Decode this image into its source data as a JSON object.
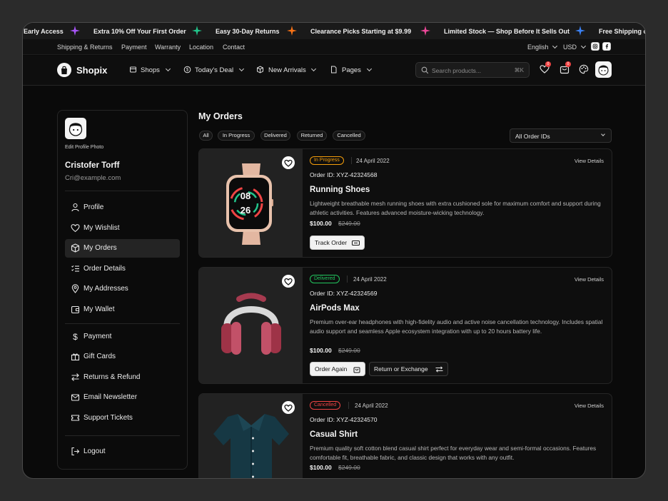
{
  "marquee": {
    "items": [
      "Early Access",
      "Extra 10% Off Your First Order",
      "Easy 30-Day Returns",
      "Clearance Picks Starting at $9.99",
      "Limited Stock — Shop Before It Sells Out",
      "Free Shipping o"
    ],
    "star_colors": [
      "#a855f7",
      "#22c58b",
      "#f97316",
      "#ec4899",
      "#3b82f6"
    ]
  },
  "utility": {
    "links": [
      "Shipping & Returns",
      "Payment",
      "Warranty",
      "Location",
      "Contact"
    ],
    "language": "English",
    "currency": "USD"
  },
  "header": {
    "brand": "Shopix",
    "nav": [
      "Shops",
      "Today's Deal",
      "New Arrivals",
      "Pages"
    ],
    "search_placeholder": "Search products...",
    "search_shortcut": "⌘K",
    "wishlist_count": "0",
    "cart_count": "0"
  },
  "sidebar": {
    "edit_photo": "Edit Profile Photo",
    "name": "Cristofer Torff",
    "email": "Cri@example.com",
    "group1": [
      {
        "label": "Profile",
        "icon": "user-icon"
      },
      {
        "label": "My Wishlist",
        "icon": "heart-icon"
      },
      {
        "label": "My Orders",
        "icon": "box-icon",
        "active": true
      },
      {
        "label": "Order Details",
        "icon": "list-icon"
      },
      {
        "label": "My Addresses",
        "icon": "map-pin-icon"
      },
      {
        "label": "My Wallet",
        "icon": "wallet-icon"
      }
    ],
    "group2": [
      {
        "label": "Payment",
        "icon": "dollar-icon"
      },
      {
        "label": "Gift Cards",
        "icon": "gift-icon"
      },
      {
        "label": "Returns & Refund",
        "icon": "swap-icon"
      },
      {
        "label": "Email Newsletter",
        "icon": "mail-icon"
      },
      {
        "label": "Support Tickets",
        "icon": "ticket-icon"
      }
    ],
    "logout": "Logout"
  },
  "main": {
    "title": "My Orders",
    "filters": [
      "All",
      "In Progress",
      "Delivered",
      "Returned",
      "Cancelled"
    ],
    "order_select": "All Order IDs",
    "orders": [
      {
        "status": "In Progress",
        "status_color": "#f59e0b",
        "date": "24 April 2022",
        "view": "View Details",
        "order_id": "Order ID: XYZ-42324568",
        "title": "Running Shoes",
        "desc": "Lightweight breathable mesh running shoes with extra cushioned sole for maximum comfort and support during athletic activities. Features advanced moisture-wicking technology.",
        "price": "$100.00",
        "old_price": "$249.00",
        "buttons": [
          "Track Order"
        ],
        "image": "smartwatch",
        "watch_time_hour": "08",
        "watch_time_min": "26"
      },
      {
        "status": "Delivered",
        "status_color": "#22c55e",
        "date": "24 April 2022",
        "view": "View Details",
        "order_id": "Order ID: XYZ-42324569",
        "title": "AirPods Max",
        "desc": "Premium over-ear headphones with high-fidelity audio and active noise cancellation technology. Includes spatial audio support and seamless Apple ecosystem integration with up to 20 hours battery life.",
        "price": "$100.00",
        "old_price": "$249.00",
        "buttons": [
          "Order Again",
          "Return or Exchange"
        ],
        "image": "headphones"
      },
      {
        "status": "Cancelled",
        "status_color": "#ef4444",
        "date": "24 April 2022",
        "view": "View Details",
        "order_id": "Order ID: XYZ-42324570",
        "title": "Casual Shirt",
        "desc": "Premium quality soft cotton blend casual shirt perfect for everyday wear and semi-formal occasions. Features comfortable fit, breathable fabric, and classic design that works with any outfit.",
        "price": "$100.00",
        "old_price": "$249.00",
        "buttons": [],
        "image": "shirt"
      }
    ]
  }
}
